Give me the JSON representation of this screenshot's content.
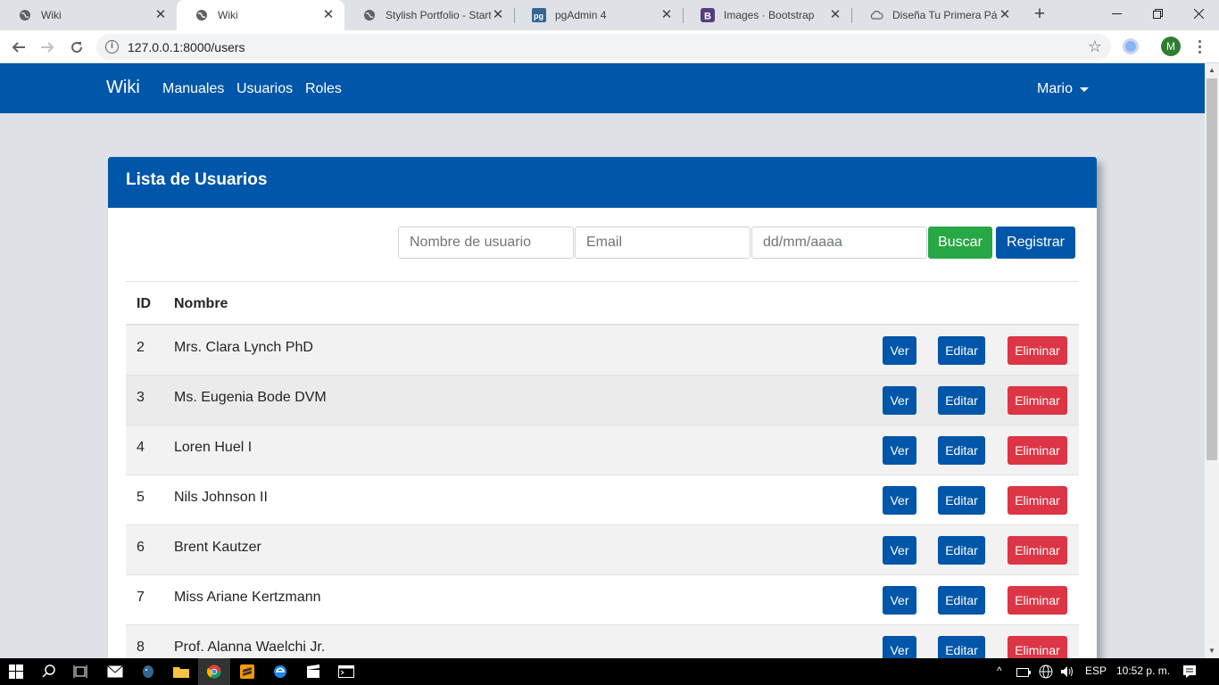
{
  "browser": {
    "tabs": [
      {
        "title": "Wiki",
        "icon": "globe-icon",
        "active": false
      },
      {
        "title": "Wiki",
        "icon": "globe-icon",
        "active": true
      },
      {
        "title": "Stylish Portfolio - Start B",
        "icon": "globe-icon",
        "active": false
      },
      {
        "title": "pgAdmin 4",
        "icon": "pgadmin-icon",
        "active": false
      },
      {
        "title": "Images · Bootstrap",
        "icon": "bootstrap-icon",
        "active": false
      },
      {
        "title": "Diseña Tu Primera Págin",
        "icon": "cloud-icon",
        "active": false
      }
    ],
    "tab_close_glyph": "✕",
    "new_tab_glyph": "+",
    "url": "127.0.0.1:8000/users",
    "profile_initial": "M"
  },
  "navbar": {
    "brand": "Wiki",
    "links": [
      "Manuales",
      "Usuarios",
      "Roles"
    ],
    "user": "Mario"
  },
  "card": {
    "title": "Lista de Usuarios"
  },
  "search": {
    "username_placeholder": "Nombre de usuario",
    "email_placeholder": "Email",
    "date_placeholder": "dd/mm/aaaa",
    "buscar_label": "Buscar",
    "registrar_label": "Registrar"
  },
  "table": {
    "headers": {
      "id": "ID",
      "name": "Nombre"
    },
    "rows": [
      {
        "id": "2",
        "name": "Mrs. Clara Lynch PhD"
      },
      {
        "id": "3",
        "name": "Ms. Eugenia Bode DVM"
      },
      {
        "id": "4",
        "name": "Loren Huel I"
      },
      {
        "id": "5",
        "name": "Nils Johnson II"
      },
      {
        "id": "6",
        "name": "Brent Kautzer"
      },
      {
        "id": "7",
        "name": "Miss Ariane Kertzmann"
      },
      {
        "id": "8",
        "name": "Prof. Alanna Waelchi Jr."
      }
    ],
    "actions": {
      "ver": "Ver",
      "editar": "Editar",
      "eliminar": "Eliminar"
    }
  },
  "taskbar": {
    "language": "ESP",
    "time": "10:52 p. m."
  },
  "colors": {
    "primary": "#0056a8",
    "success": "#28a745",
    "danger": "#dc3545",
    "page_bg": "#dee2e6"
  }
}
